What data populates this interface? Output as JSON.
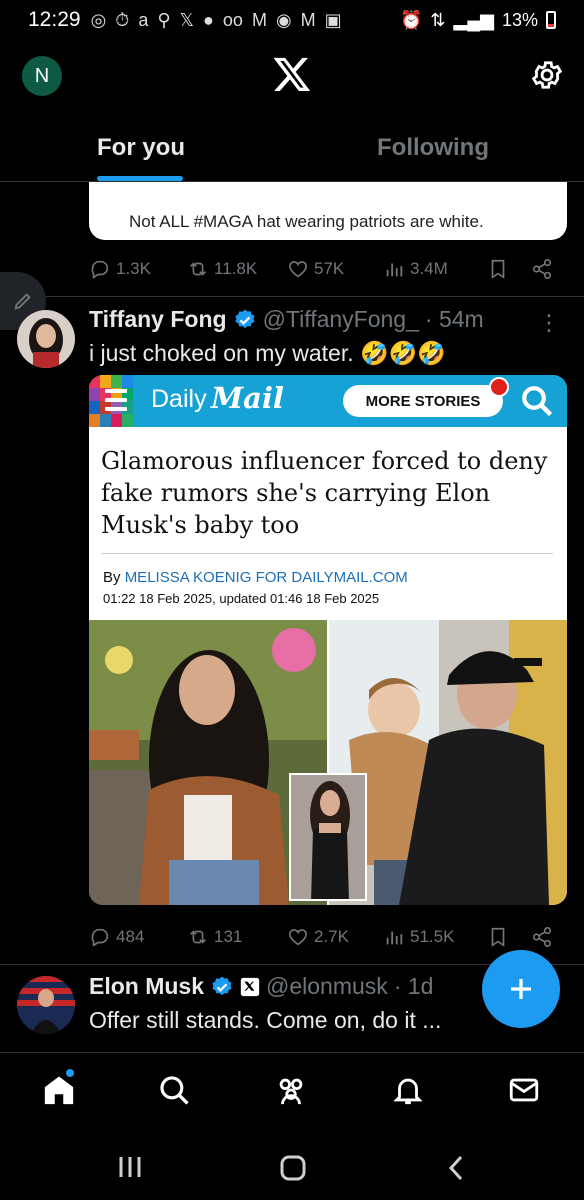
{
  "status_bar": {
    "time": "12:29",
    "left_icons": [
      "whatsapp-icon",
      "timer-icon",
      "amazon-icon",
      "pin-icon",
      "x-icon",
      "circle-icon",
      "voicemail-icon",
      "gmail-icon",
      "record-icon",
      "gmail-icon",
      "image-icon"
    ],
    "right_icons": [
      "alarm-icon",
      "volte-icon",
      "signal-icon"
    ],
    "battery": "13%"
  },
  "header": {
    "account_initial": "N"
  },
  "tabs": [
    {
      "label": "For you",
      "active": true
    },
    {
      "label": "Following",
      "active": false
    }
  ],
  "quoted_remnant": {
    "text": "Not ALL #MAGA hat wearing patriots are white."
  },
  "tweet1_actions": {
    "replies": "1.3K",
    "reposts": "11.8K",
    "likes": "57K",
    "views": "3.4M"
  },
  "tweet2": {
    "name": "Tiffany Fong",
    "handle": "@TiffanyFong_",
    "time": "· 54m",
    "text": "i just choked on my water. 🤣🤣🤣",
    "card": {
      "brand_daily": "Daily",
      "brand_mail": "Mail",
      "more_stories": "MORE STORIES",
      "headline": "Glamorous influencer forced to deny fake rumors she's carrying Elon Musk's baby too",
      "byline_prefix": "By",
      "byline_author": "MELISSA KOENIG FOR DAILYMAIL.COM",
      "dateline": "01:22 18 Feb 2025, updated 01:46 18 Feb 2025"
    },
    "actions": {
      "replies": "484",
      "reposts": "131",
      "likes": "2.7K",
      "views": "51.5K"
    }
  },
  "tweet3": {
    "name": "Elon Musk",
    "handle": "@elonmusk",
    "time": "· 1d",
    "text": "Offer still stands. Come on, do it ..."
  },
  "bottom_nav": [
    "home-icon",
    "search-icon",
    "communities-icon",
    "notifications-icon",
    "messages-icon"
  ],
  "colors": {
    "accent": "#1d9bf0",
    "background": "#000000",
    "secondary_text": "#71767b",
    "dailymail_bar": "#17a2d6"
  }
}
